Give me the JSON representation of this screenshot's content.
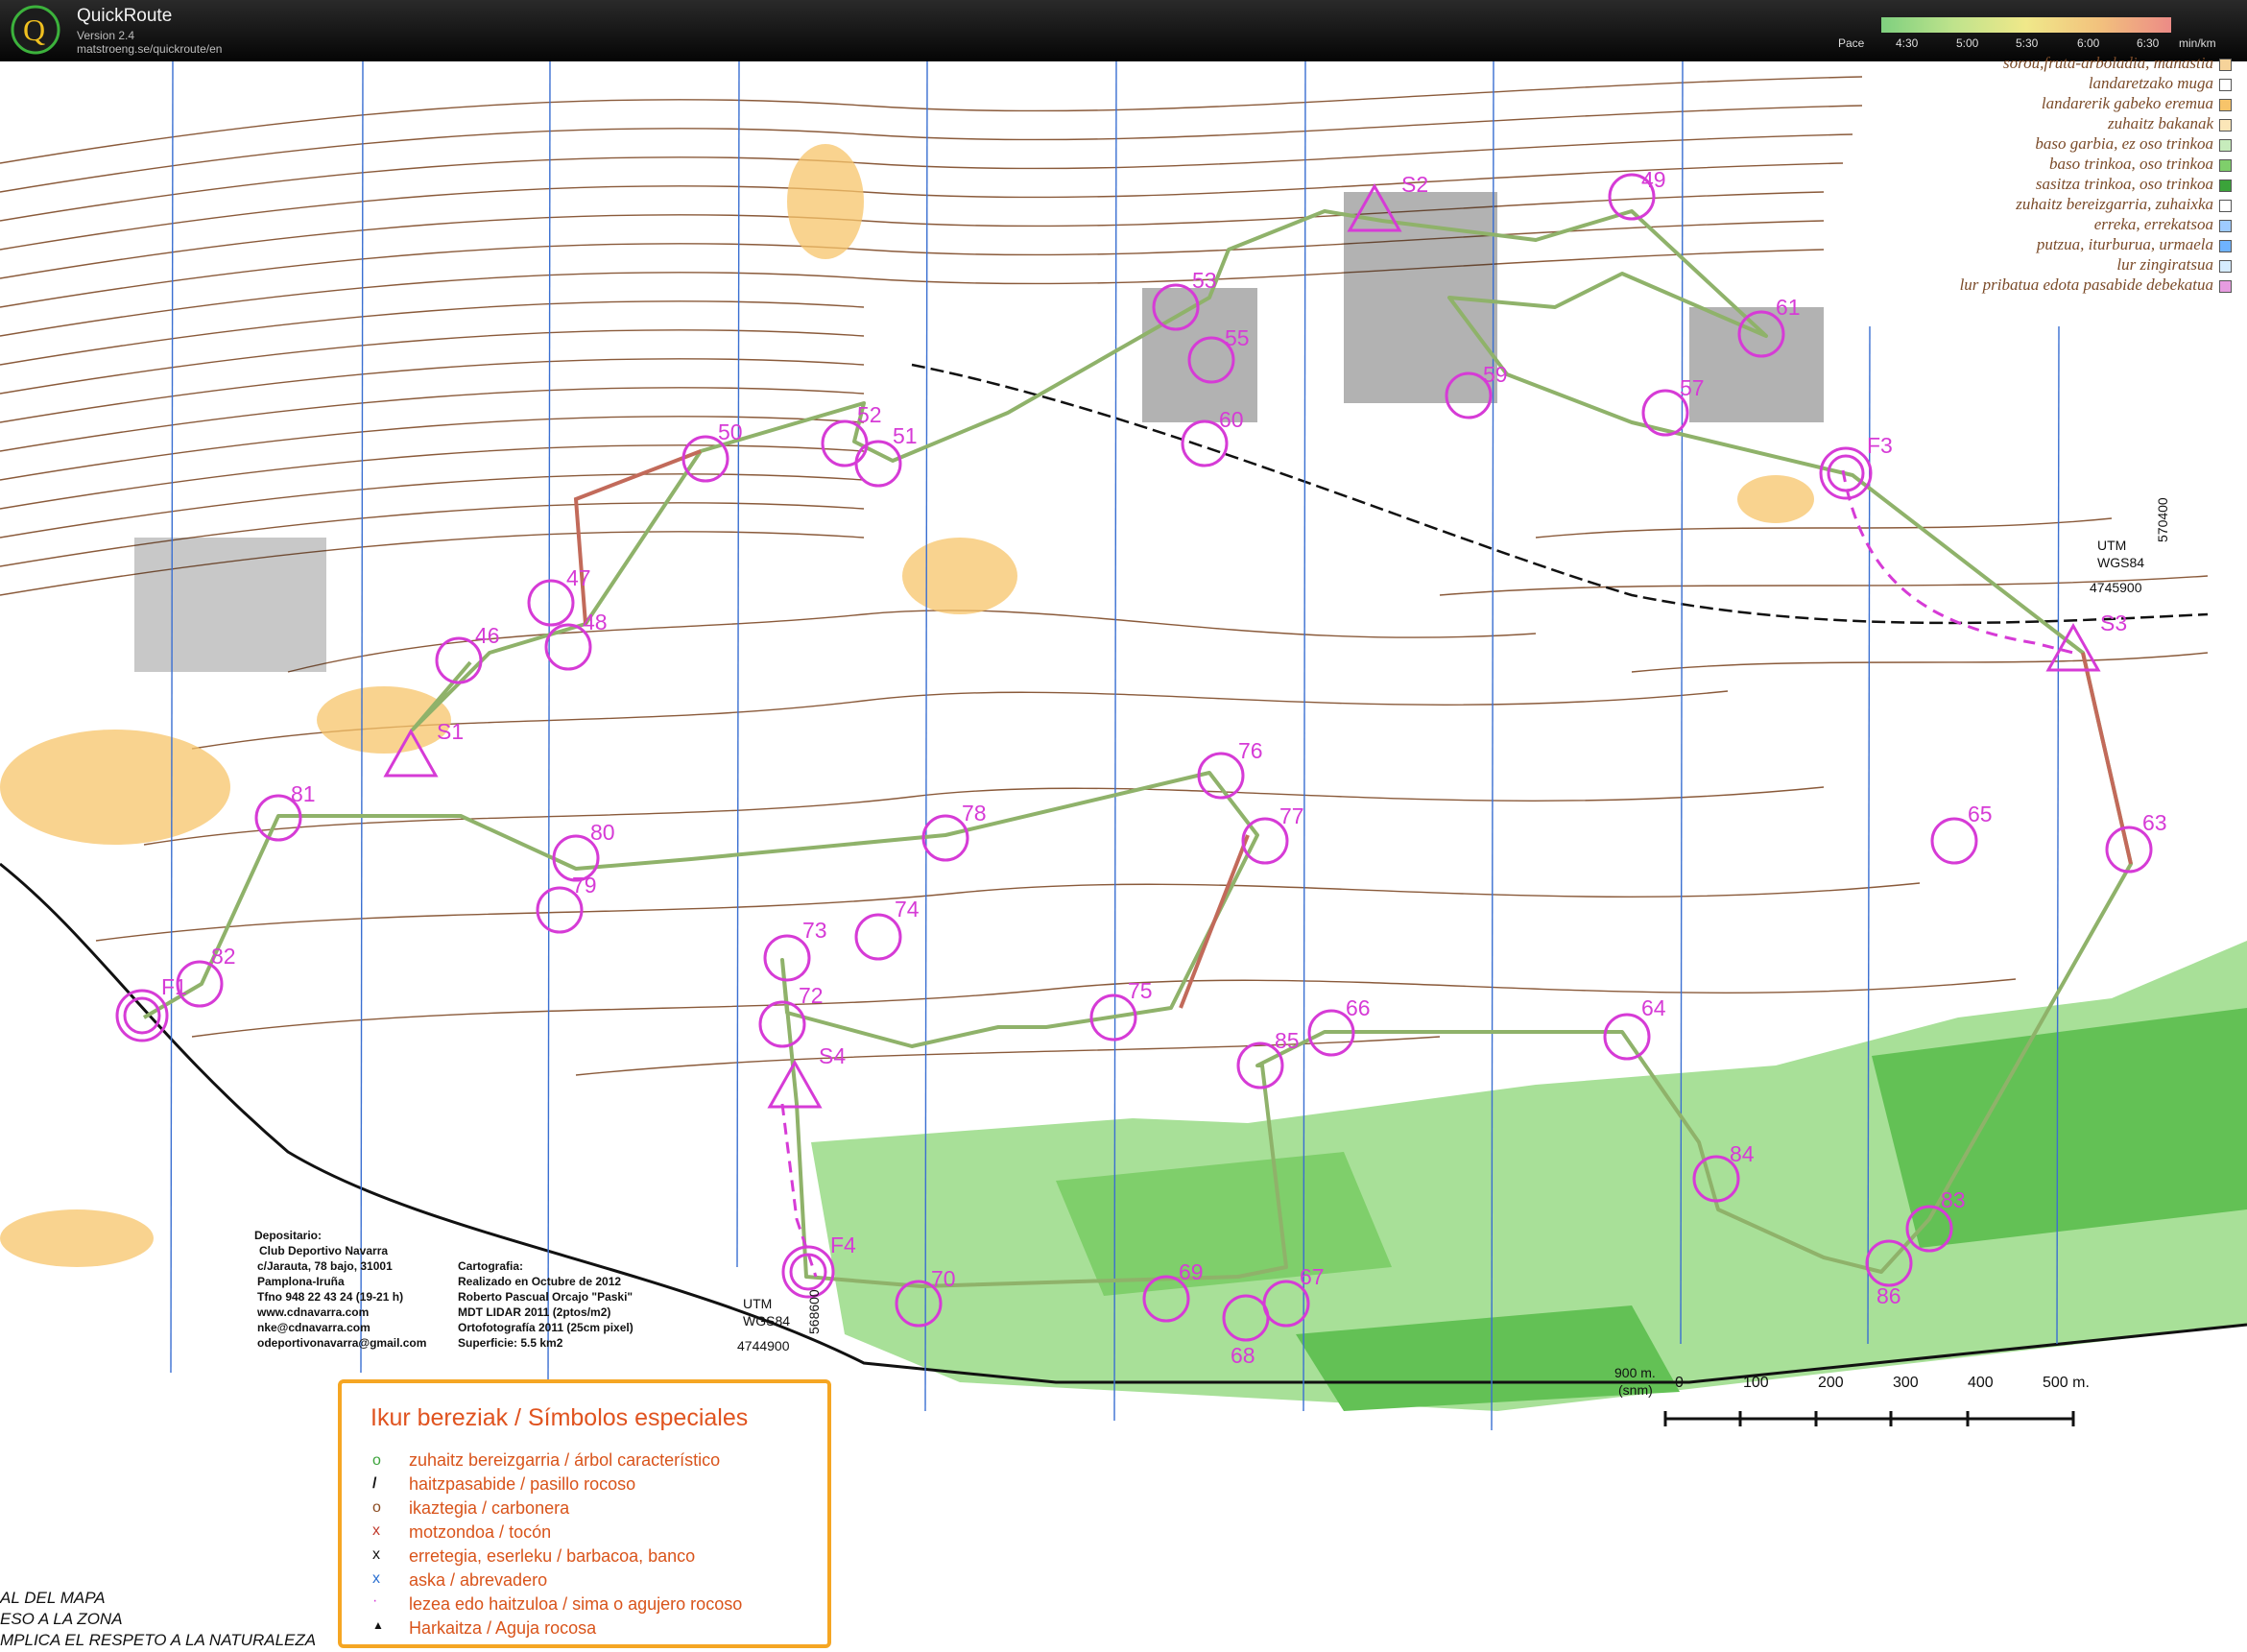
{
  "app": {
    "title": "QuickRoute",
    "version": "Version 2.4",
    "url": "matstroeng.se/quickroute/en"
  },
  "pace_scale": {
    "label": "Pace",
    "ticks": [
      "4:30",
      "5:00",
      "5:30",
      "6:00",
      "6:30"
    ],
    "unit": "min/km",
    "colors": [
      "#7fd07f",
      "#bfe38c",
      "#f0e88a",
      "#f2c27d",
      "#ec8b86"
    ]
  },
  "map_legend": [
    "sorou,fruta-arboladia, manastia",
    "landaretzako muga",
    "landarerik gabeko eremua",
    "zuhaitz bakanak",
    "baso garbia, ez oso trinkoa",
    "baso trinkoa, oso trinkoa",
    "sasitza trinkoa, oso trinkoa",
    "zuhaitz bereizgarria, zuhaixka",
    "erreka, errekatsoa",
    "putzua, iturburua, urmaela",
    "lur zingiratsua",
    "lur pribatua edota pasabide debekatua"
  ],
  "special_symbols": {
    "title": "Ikur bereziak / Símbolos especiales",
    "items": [
      {
        "icon": "o",
        "text": "zuhaitz bereizgarria / árbol característico"
      },
      {
        "icon": "/",
        "text": "haitzpasabide / pasillo rocoso"
      },
      {
        "icon": "o",
        "text": "ikaztegia / carbonera"
      },
      {
        "icon": "x",
        "text": "motzondoa / tocón"
      },
      {
        "icon": "x",
        "text": "erretegia, eserleku / barbacoa, banco"
      },
      {
        "icon": "x",
        "text": "aska / abrevadero"
      },
      {
        "icon": "·",
        "text": "lezea edo haitzuloa / sima o agujero rocoso"
      },
      {
        "icon": "▲",
        "text": "Harkaitza / Aguja rocosa"
      }
    ]
  },
  "depositario": [
    "Depositario:",
    "Club Deportivo Navarra",
    "c/Jarauta, 78 bajo, 31001",
    "Pamplona-Iruña",
    "Tfno 948 22 43 24 (19-21 h)",
    "www.cdnavarra.com",
    "nke@cdnavarra.com",
    "odeportivonavarra@gmail.com"
  ],
  "cartografia": [
    "Cartografia:",
    "Realizado en Octubre de 2012",
    "Roberto Pascual Orcajo \"Paski\"",
    "MDT LIDAR 2011 (2ptos/m2)",
    "Ortofotografía 2011 (25cm pixel)",
    "Superficie: 5.5 km2"
  ],
  "notices": [
    "AL DEL MAPA",
    "ESO A LA ZONA",
    "MPLICA EL RESPETO A LA NATURALEZA"
  ],
  "utm_labels": {
    "top_right": [
      "UTM",
      "WGS84",
      "4745900",
      "570400"
    ],
    "bottom_left": [
      "UTM",
      "WGS84",
      "4744900",
      "568600"
    ]
  },
  "elevation_label": [
    "900 m.",
    "(snm)"
  ],
  "scale_bar": [
    "0",
    "100",
    "200",
    "300",
    "400",
    "500 m."
  ],
  "controls": [
    {
      "label": "49"
    },
    {
      "label": "50"
    },
    {
      "label": "51"
    },
    {
      "label": "52"
    },
    {
      "label": "53"
    },
    {
      "label": "55"
    },
    {
      "label": "57"
    },
    {
      "label": "59"
    },
    {
      "label": "60"
    },
    {
      "label": "61"
    },
    {
      "label": "63"
    },
    {
      "label": "64"
    },
    {
      "label": "65"
    },
    {
      "label": "66"
    },
    {
      "label": "67"
    },
    {
      "label": "68"
    },
    {
      "label": "69"
    },
    {
      "label": "70"
    },
    {
      "label": "72"
    },
    {
      "label": "73"
    },
    {
      "label": "74"
    },
    {
      "label": "75"
    },
    {
      "label": "76"
    },
    {
      "label": "77"
    },
    {
      "label": "78"
    },
    {
      "label": "79"
    },
    {
      "label": "80"
    },
    {
      "label": "81"
    },
    {
      "label": "82"
    },
    {
      "label": "83"
    },
    {
      "label": "84"
    },
    {
      "label": "85"
    },
    {
      "label": "86"
    },
    {
      "label": "46"
    },
    {
      "label": "47"
    },
    {
      "label": "48"
    }
  ],
  "special_points": [
    {
      "label": "S1"
    },
    {
      "label": "S2"
    },
    {
      "label": "S3"
    },
    {
      "label": "S4"
    },
    {
      "label": "F1"
    },
    {
      "label": "F3"
    },
    {
      "label": "F4"
    }
  ]
}
